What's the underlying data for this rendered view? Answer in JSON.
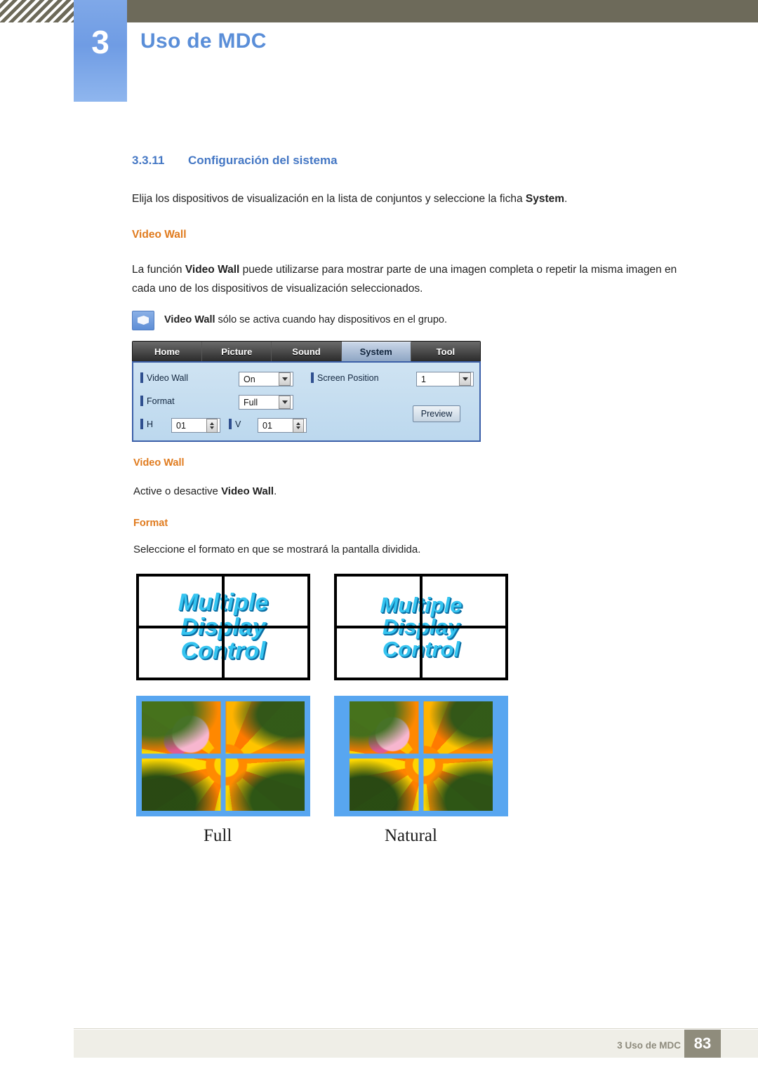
{
  "header": {
    "chapter_number": "3",
    "chapter_title": "Uso de MDC"
  },
  "section": {
    "number": "3.3.11",
    "title": "Configuración del sistema",
    "intro_before": "Elija los dispositivos de visualización en la lista de conjuntos y seleccione la ficha ",
    "intro_bold": "System",
    "intro_after": "."
  },
  "video_wall": {
    "heading": "Video Wall",
    "para_a": "La función ",
    "para_b": "Video Wall",
    "para_c": " puede utilizarse para mostrar parte de una imagen completa o repetir la misma imagen en cada uno de los dispositivos de visualización seleccionados.",
    "note_bold": "Video Wall",
    "note_rest": " sólo se activa cuando hay dispositivos en el grupo."
  },
  "mdc_ui": {
    "tabs": [
      {
        "label": "Home",
        "active": false
      },
      {
        "label": "Picture",
        "active": false
      },
      {
        "label": "Sound",
        "active": false
      },
      {
        "label": "System",
        "active": true
      },
      {
        "label": "Tool",
        "active": false
      }
    ],
    "fields": {
      "video_wall_label": "Video Wall",
      "video_wall_value": "On",
      "format_label": "Format",
      "format_value": "Full",
      "h_label": "H",
      "h_value": "01",
      "v_label": "V",
      "v_value": "01",
      "screen_position_label": "Screen Position",
      "screen_position_value": "1",
      "preview_label": "Preview"
    }
  },
  "descriptions": {
    "videowall_heading": "Video Wall",
    "videowall_text_a": "Active o desactive ",
    "videowall_text_b": "Video Wall",
    "videowall_text_c": ".",
    "format_heading": "Format",
    "format_text": "Seleccione el formato en que se mostrará la pantalla dividida."
  },
  "diagrams": {
    "wordart_lines": [
      "Multiple",
      "Display",
      "Control"
    ],
    "caption_left": "Full",
    "caption_right": "Natural"
  },
  "footer": {
    "text": "3 Uso de MDC",
    "page": "83"
  },
  "colors": {
    "accent_blue": "#4477c4",
    "accent_orange": "#e07b1e",
    "header_band": "#6d6a5a",
    "wordart": "#35c4f0",
    "photo_border": "#58a6f0"
  }
}
